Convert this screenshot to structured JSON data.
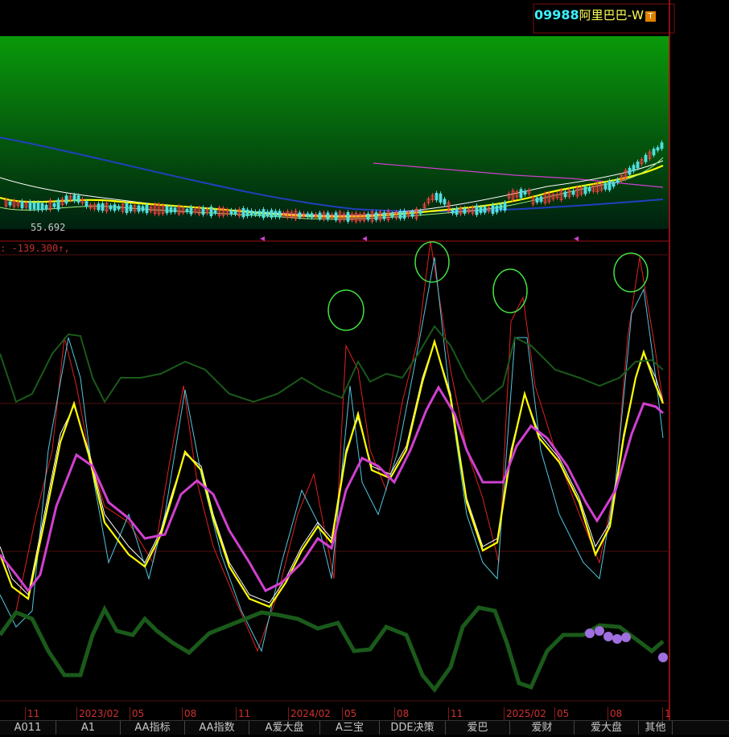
{
  "stock": {
    "code": "09988",
    "name": "阿里巴巴-W",
    "badge": "T"
  },
  "price_panel": {
    "low_label": "55.692"
  },
  "indicator": {
    "value_text": ": -139.300↑,"
  },
  "date_axis": [
    "11",
    "2023/02",
    "05",
    "08",
    "11",
    "2024/02",
    "05",
    "08",
    "11",
    "2025/02",
    "05",
    "08",
    "1"
  ],
  "tabs": [
    "A011",
    "A1",
    "AA指标",
    "AA指数",
    "A爱大盘",
    "A三宝",
    "DDE决策",
    "爱巴",
    "爱财",
    "爱大盘",
    "其他"
  ],
  "colors": {
    "panel_bg": "#000000",
    "green_gradient_top": "#0a9a0a",
    "frame_red": "#c01010",
    "white_line": "#ffffff",
    "yellow_line": "#ffff00",
    "magenta_line": "#d040d0",
    "red_line": "#e02020",
    "cyan_line": "#50c8e0",
    "dark_green_line": "#1a5a1a",
    "annotation_green": "#40e040",
    "purple_marker": "#a070e0"
  },
  "chart_data": [
    {
      "type": "line",
      "title": "",
      "series": [],
      "note_values": [
        "55.692"
      ]
    },
    {
      "type": "line",
      "title": "",
      "categories": [
        "11",
        "2023/02",
        "05",
        "08",
        "11",
        "2024/02",
        "05",
        "08",
        "11",
        "2025/02",
        "05",
        "08",
        "1"
      ],
      "series": []
    }
  ]
}
